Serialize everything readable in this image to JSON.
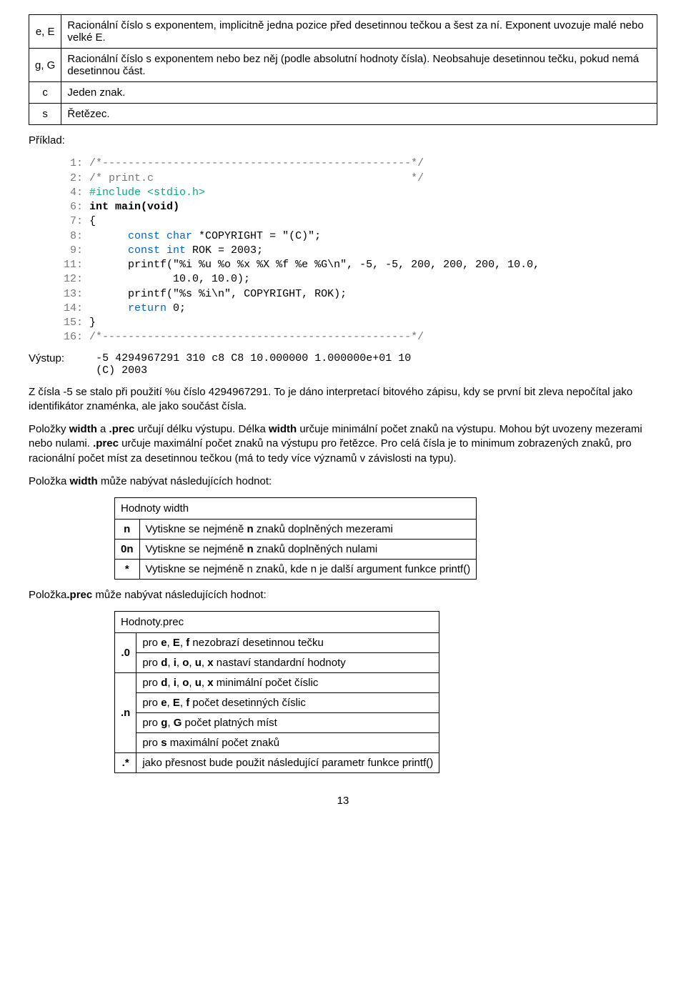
{
  "table1": {
    "rows": [
      {
        "key": "e, E",
        "desc": "Racionální číslo s exponentem, implicitně jedna pozice před desetinnou tečkou a šest za ní. Exponent uvozuje malé nebo velké E."
      },
      {
        "key": "g, G",
        "desc": "Racionální číslo s exponentem nebo bez něj (podle absolutní hodnoty čísla). Neobsahuje desetinnou tečku, pokud nemá desetinnou část."
      },
      {
        "key": "c",
        "desc": "Jeden znak."
      },
      {
        "key": "s",
        "desc": "Řetězec."
      }
    ]
  },
  "example_label": "Příklad:",
  "code": {
    "l1_ln": "  1:",
    "l1_a": " /*------------------------------------------------*/",
    "l2_ln": "  2:",
    "l2_a": " /* print.c                                        */",
    "l4_ln": "  4:",
    "l4_a": " #include <stdio.h>",
    "l6_ln": "  6:",
    "l6_a": " int",
    "l6_b": " main(",
    "l6_c": "void",
    "l6_d": ")",
    "l7_ln": "  7:",
    "l7_a": " {",
    "l8_ln": "  8:",
    "l8_a": "       const char",
    "l8_b": " *COPYRIGHT = ",
    "l8_c": "\"(C)\"",
    "l8_d": ";",
    "l9_ln": "  9:",
    "l9_a": "       const int",
    "l9_b": " ROK = 2003;",
    "l11_ln": " 11:",
    "l11_a": "       printf(",
    "l11_b": "\"%i %u %o %x %X %f %e %G\\n\"",
    "l11_c": ", -5, -5, 200, 200, 200, 10.0,",
    "l12_ln": " 12:",
    "l12_a": "              10.0, 10.0);",
    "l13_ln": " 13:",
    "l13_a": "       printf(",
    "l13_b": "\"%s %i\\n\"",
    "l13_c": ", COPYRIGHT, ROK);",
    "l14_ln": " 14:",
    "l14_a": "       return",
    "l14_b": " 0;",
    "l15_ln": " 15:",
    "l15_a": " }",
    "l16_ln": " 16:",
    "l16_a": " /*------------------------------------------------*/"
  },
  "output": {
    "label": "Výstup:",
    "line1": "-5 4294967291 310 c8 C8 10.000000 1.000000e+01 10",
    "line2": "(C) 2003"
  },
  "para1": "Z čísla -5 se stalo při použití %u číslo 4294967291. To je dáno interpretací bitového zápisu, kdy se první bit zleva nepočítal jako identifikátor znaménka, ale jako součást čísla.",
  "para2_a": "Položky ",
  "para2_b": "width",
  "para2_c": " a ",
  "para2_d": ".prec",
  "para2_e": " určují délku výstupu. Délka ",
  "para2_f": "width",
  "para2_g": " určuje minimální počet znaků na výstupu. Mohou být uvozeny mezerami nebo nulami. ",
  "para2_h": ".prec",
  "para2_i": " určuje maximální počet znaků na výstupu pro řetězce. Pro celá čísla je to minimum zobrazených znaků, pro racionální počet míst za desetinnou tečkou (má to tedy více významů v závislosti na typu).",
  "para3_a": "Položka ",
  "para3_b": "width",
  "para3_c": " může nabývat následujících hodnot:",
  "table_width": {
    "caption": "Hodnoty width",
    "rows": [
      {
        "key": "n",
        "desc_a": "Vytiskne se nejméně ",
        "desc_b": "n",
        "desc_c": " znaků doplněných mezerami"
      },
      {
        "key": "0n",
        "desc_a": "Vytiskne se nejméně ",
        "desc_b": "n",
        "desc_c": " znaků doplněných nulami"
      },
      {
        "key": "*",
        "desc_a": "Vytiskne se nejméně n znaků, kde n je další argument funkce printf()",
        "desc_b": "",
        "desc_c": ""
      }
    ]
  },
  "para4_a": "Položka",
  "para4_b": ".prec",
  "para4_c": " může nabývat následujících hodnot:",
  "table_prec": {
    "caption": "Hodnoty.prec",
    "group1_key": ".0",
    "group1_rows": [
      {
        "desc_a": "pro ",
        "desc_b": "e",
        "desc_c": ", ",
        "desc_d": "E",
        "desc_e": ", ",
        "desc_f": "f",
        "desc_g": " nezobrazí desetinnou tečku"
      },
      {
        "desc_a": "pro ",
        "desc_b": "d",
        "desc_c": ", ",
        "desc_d": "i",
        "desc_e": ", ",
        "desc_f": "o",
        "desc_g": ", ",
        "desc_h": "u",
        "desc_i": ", ",
        "desc_j": "x",
        "desc_k": " nastaví standardní hodnoty"
      }
    ],
    "group2_key": ".n",
    "group2_rows": [
      {
        "desc_a": "pro ",
        "desc_b": "d",
        "desc_c": ", ",
        "desc_d": "i",
        "desc_e": ", ",
        "desc_f": "o",
        "desc_g": ", ",
        "desc_h": "u",
        "desc_i": ", ",
        "desc_j": "x",
        "desc_k": " minimální počet číslic"
      },
      {
        "desc_a": "pro ",
        "desc_b": "e",
        "desc_c": ", ",
        "desc_d": "E",
        "desc_e": ", ",
        "desc_f": "f",
        "desc_g": " počet desetinných číslic"
      },
      {
        "desc_a": "pro ",
        "desc_b": "g",
        "desc_c": ", ",
        "desc_d": "G",
        "desc_e": " počet platných míst"
      },
      {
        "desc_a": "pro ",
        "desc_b": "s",
        "desc_c": " maximální počet znaků"
      }
    ],
    "group3_key": ".*",
    "group3_rows": [
      {
        "desc_a": "jako přesnost bude použit následující parametr funkce printf()"
      }
    ]
  },
  "page_number": "13"
}
